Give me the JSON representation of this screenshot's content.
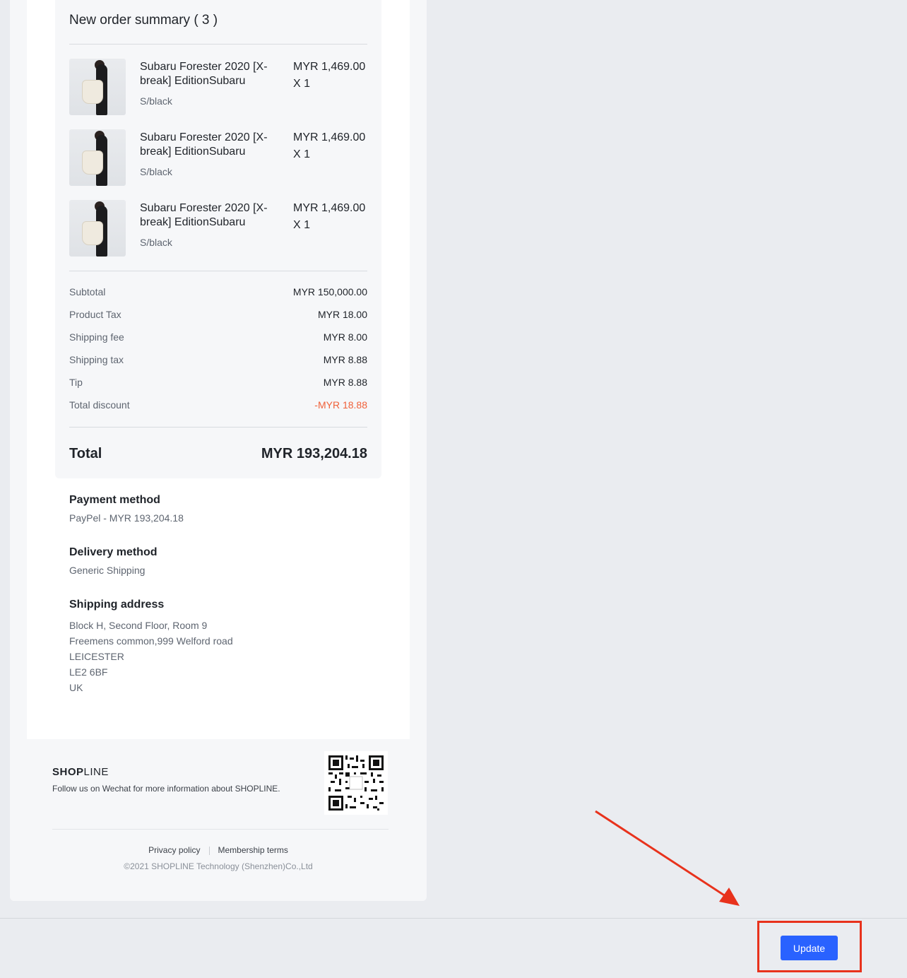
{
  "summary": {
    "title": "New order summary ( 3 )",
    "items": [
      {
        "name": "Subaru Forester 2020 [X-break] EditionSubaru",
        "variant": "S/black",
        "price": "MYR 1,469.00",
        "qty": "X 1"
      },
      {
        "name": "Subaru Forester 2020 [X-break] EditionSubaru",
        "variant": "S/black",
        "price": "MYR 1,469.00",
        "qty": "X 1"
      },
      {
        "name": "Subaru Forester 2020 [X-break] EditionSubaru",
        "variant": "S/black",
        "price": "MYR 1,469.00",
        "qty": "X 1"
      }
    ],
    "rows": [
      {
        "label": "Subtotal",
        "value": "MYR 150,000.00"
      },
      {
        "label": "Product Tax",
        "value": "MYR 18.00"
      },
      {
        "label": "Shipping fee",
        "value": "MYR 8.00"
      },
      {
        "label": "Shipping tax",
        "value": "MYR 8.88"
      },
      {
        "label": "Tip",
        "value": "MYR 8.88"
      },
      {
        "label": "Total discount",
        "value": "-MYR 18.88"
      }
    ],
    "total_label": "Total",
    "total_value": "MYR 193,204.18"
  },
  "payment": {
    "title": "Payment method",
    "value": "PayPel - MYR 193,204.18"
  },
  "delivery": {
    "title": "Delivery method",
    "value": "Generic Shipping"
  },
  "shipping": {
    "title": "Shipping address",
    "lines": [
      "Block H, Second Floor, Room 9",
      "Freemens common,999 Welford road",
      "LEICESTER",
      "LE2 6BF",
      "UK"
    ]
  },
  "footer": {
    "logo_bold": "SHOP",
    "logo_thin": "LINE",
    "follow": "Follow us on Wechat for more information about SHOPLINE.",
    "privacy": "Privacy policy",
    "membership": "Membership terms",
    "copyright": "©2021 SHOPLINE Technology (Shenzhen)Co.,Ltd"
  },
  "actions": {
    "update_label": "Update"
  },
  "colors": {
    "accent": "#2962ff",
    "discount": "#f0613a",
    "annotation": "#e8321c"
  }
}
